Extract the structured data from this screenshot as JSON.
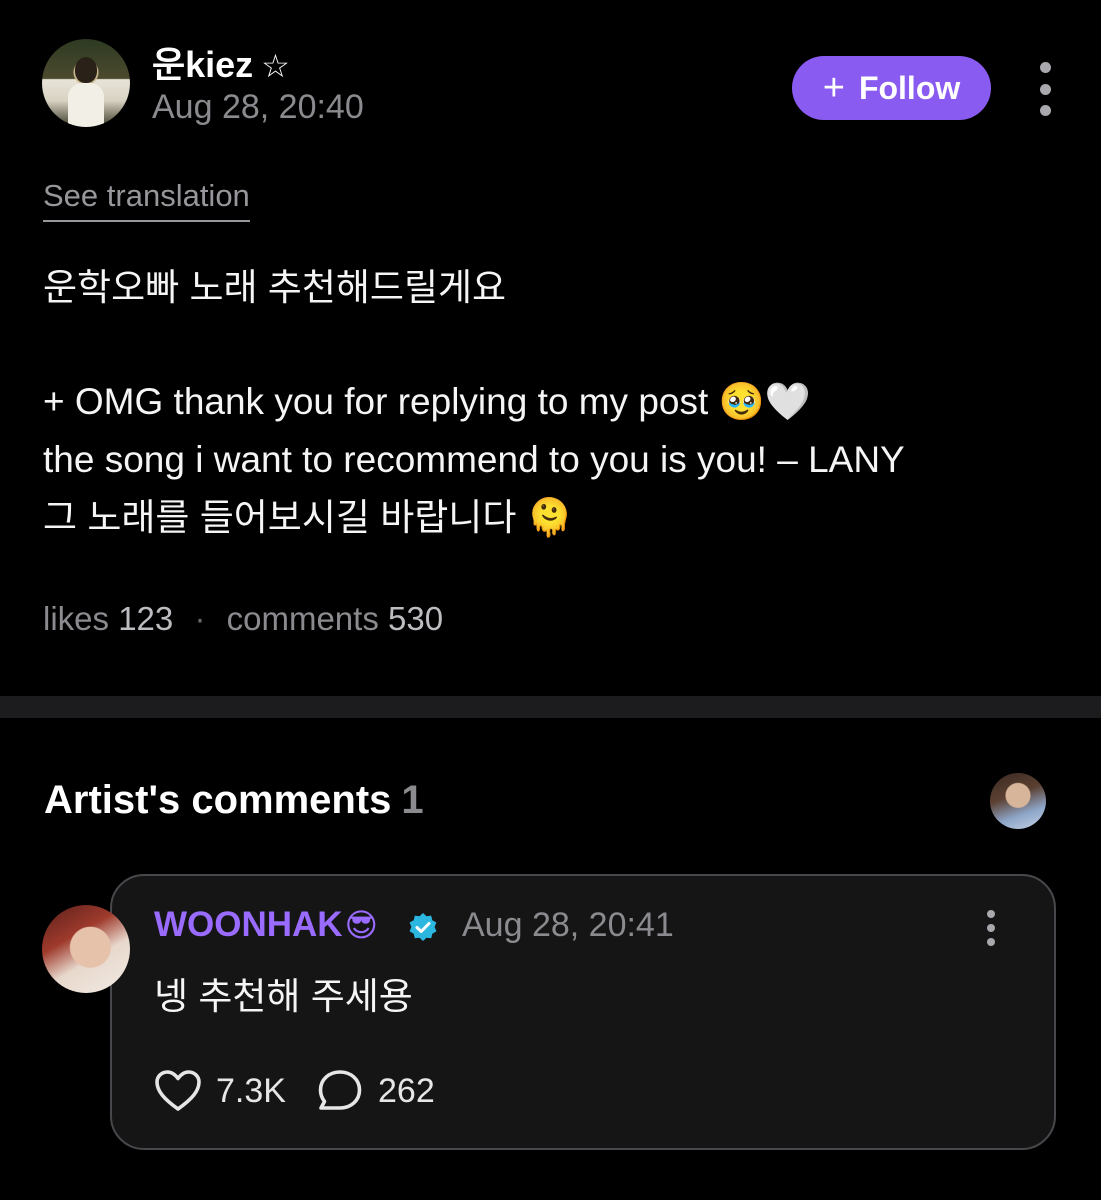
{
  "post": {
    "author": "운kiez",
    "author_badge_icon": "star-outline-icon",
    "date": "Aug 28, 20:40",
    "follow_label": "Follow",
    "see_translation": "See translation",
    "lines": [
      "운학오빠 노래 추천해드릴게요",
      "+ OMG thank you for replying to my post 🥹🤍",
      "the song i want to recommend to you is you! – LANY",
      "그 노래를 들어보시길 바랍니다 🫠"
    ],
    "stats": {
      "likes_label": "likes",
      "likes_count": "123",
      "comments_label": "comments",
      "comments_count": "530"
    }
  },
  "artist_comments": {
    "title": "Artist's comments",
    "count": "1",
    "comment": {
      "author": "WOONHAK",
      "author_emoji": "😎",
      "verified_icon": "verified-badge-icon",
      "verified_color": "#2cb7e0",
      "date": "Aug 28, 20:41",
      "text": "넹 추천해 주세용",
      "likes": "7.3K",
      "replies": "262"
    }
  },
  "colors": {
    "accent": "#8a5bf0",
    "author_name": "#9a6bff",
    "background": "#000000",
    "muted": "#8b8b8f"
  }
}
